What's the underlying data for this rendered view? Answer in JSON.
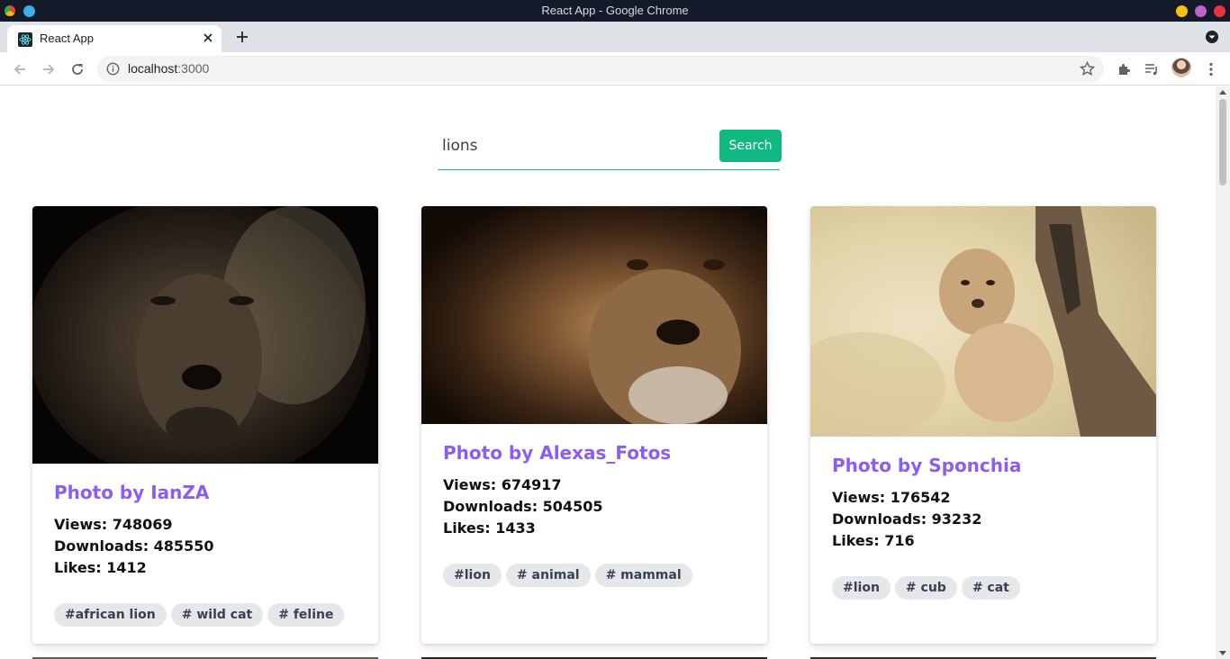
{
  "window": {
    "title": "React App - Google Chrome"
  },
  "tab": {
    "title": "React App"
  },
  "address": {
    "host": "localhost",
    "port": ":3000"
  },
  "search": {
    "value": "lions",
    "button_label": "Search"
  },
  "cards": [
    {
      "author": "Photo by IanZA",
      "views": "Views: 748069",
      "downloads": "Downloads: 485550",
      "likes": "Likes: 1412",
      "tags": [
        "#african lion",
        "# wild cat",
        "# feline"
      ]
    },
    {
      "author": "Photo by Alexas_Fotos",
      "views": "Views: 674917",
      "downloads": "Downloads: 504505",
      "likes": "Likes: 1433",
      "tags": [
        "#lion",
        "# animal",
        "# mammal"
      ]
    },
    {
      "author": "Photo by Sponchia",
      "views": "Views: 176542",
      "downloads": "Downloads: 93232",
      "likes": "Likes: 716",
      "tags": [
        "#lion",
        "# cub",
        "# cat"
      ]
    }
  ],
  "colors": {
    "accent_purple": "#8b5cf6",
    "search_green": "#10b981",
    "input_underline": "#14b8a6"
  }
}
